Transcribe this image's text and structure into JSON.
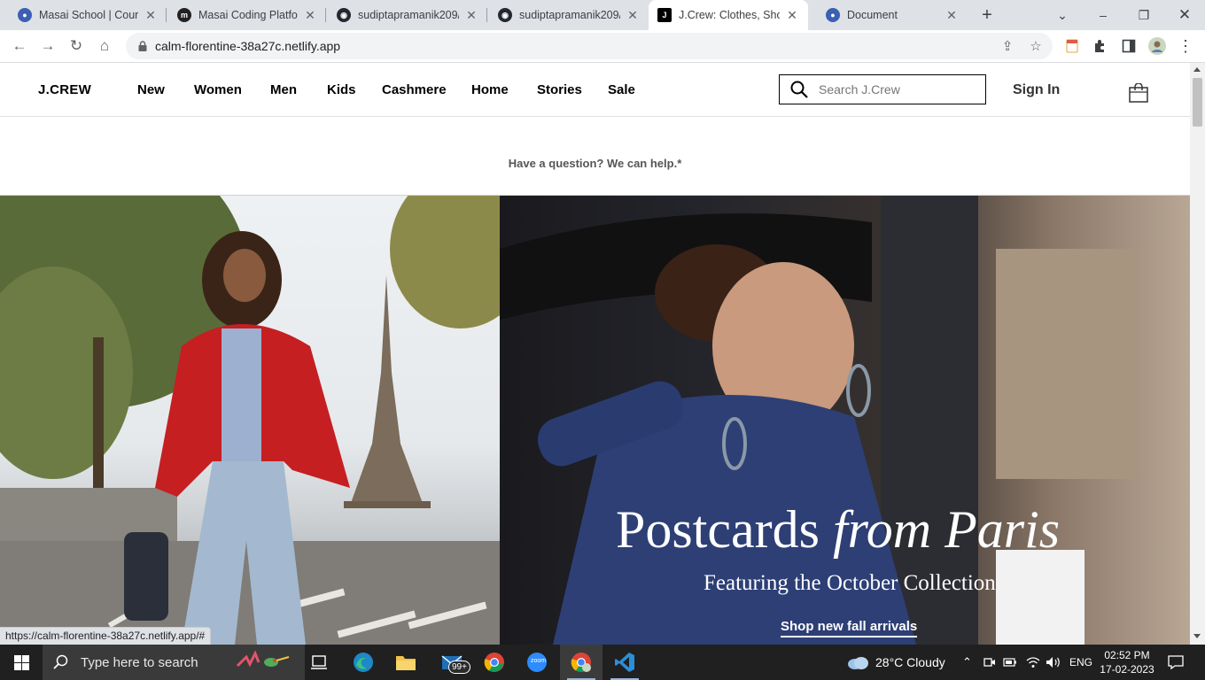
{
  "browser": {
    "tabs": [
      {
        "title": "Masai School | Course",
        "icon": "globe-icon"
      },
      {
        "title": "Masai Coding Platform",
        "icon": "masai-m-icon"
      },
      {
        "title": "sudiptapramanik209/J",
        "icon": "github-icon"
      },
      {
        "title": "sudiptapramanik209/J",
        "icon": "github-icon"
      },
      {
        "title": "J.Crew: Clothes, Shoes",
        "icon": "jcrew-icon",
        "active": true
      },
      {
        "title": "Document",
        "icon": "globe-icon"
      }
    ],
    "url": "calm-florentine-38a27c.netlify.app",
    "status_link": "https://calm-florentine-38a27c.netlify.app/#"
  },
  "site": {
    "brand": "J.CREW",
    "nav": [
      "New",
      "Women",
      "Men",
      "Kids",
      "Cashmere",
      "Home",
      "Stories",
      "Sale"
    ],
    "search_placeholder": "Search J.Crew",
    "sign_in": "Sign In",
    "help_text": "Have a question? We can help.*",
    "hero": {
      "headline_plain": "Postcards",
      "headline_italic": "from Paris",
      "subhead": "Featuring the October Collection",
      "cta": "Shop new fall arrivals"
    }
  },
  "taskbar": {
    "search_placeholder": "Type here to search",
    "mail_badge": "99+",
    "zoom_label": "zoom",
    "weather": "28°C  Cloudy",
    "language": "ENG",
    "time": "02:52 PM",
    "date": "17-02-2023"
  },
  "colors": {
    "tabstrip": "#dee1e6",
    "taskbar": "#202020",
    "hero_text": "#ffffff"
  }
}
